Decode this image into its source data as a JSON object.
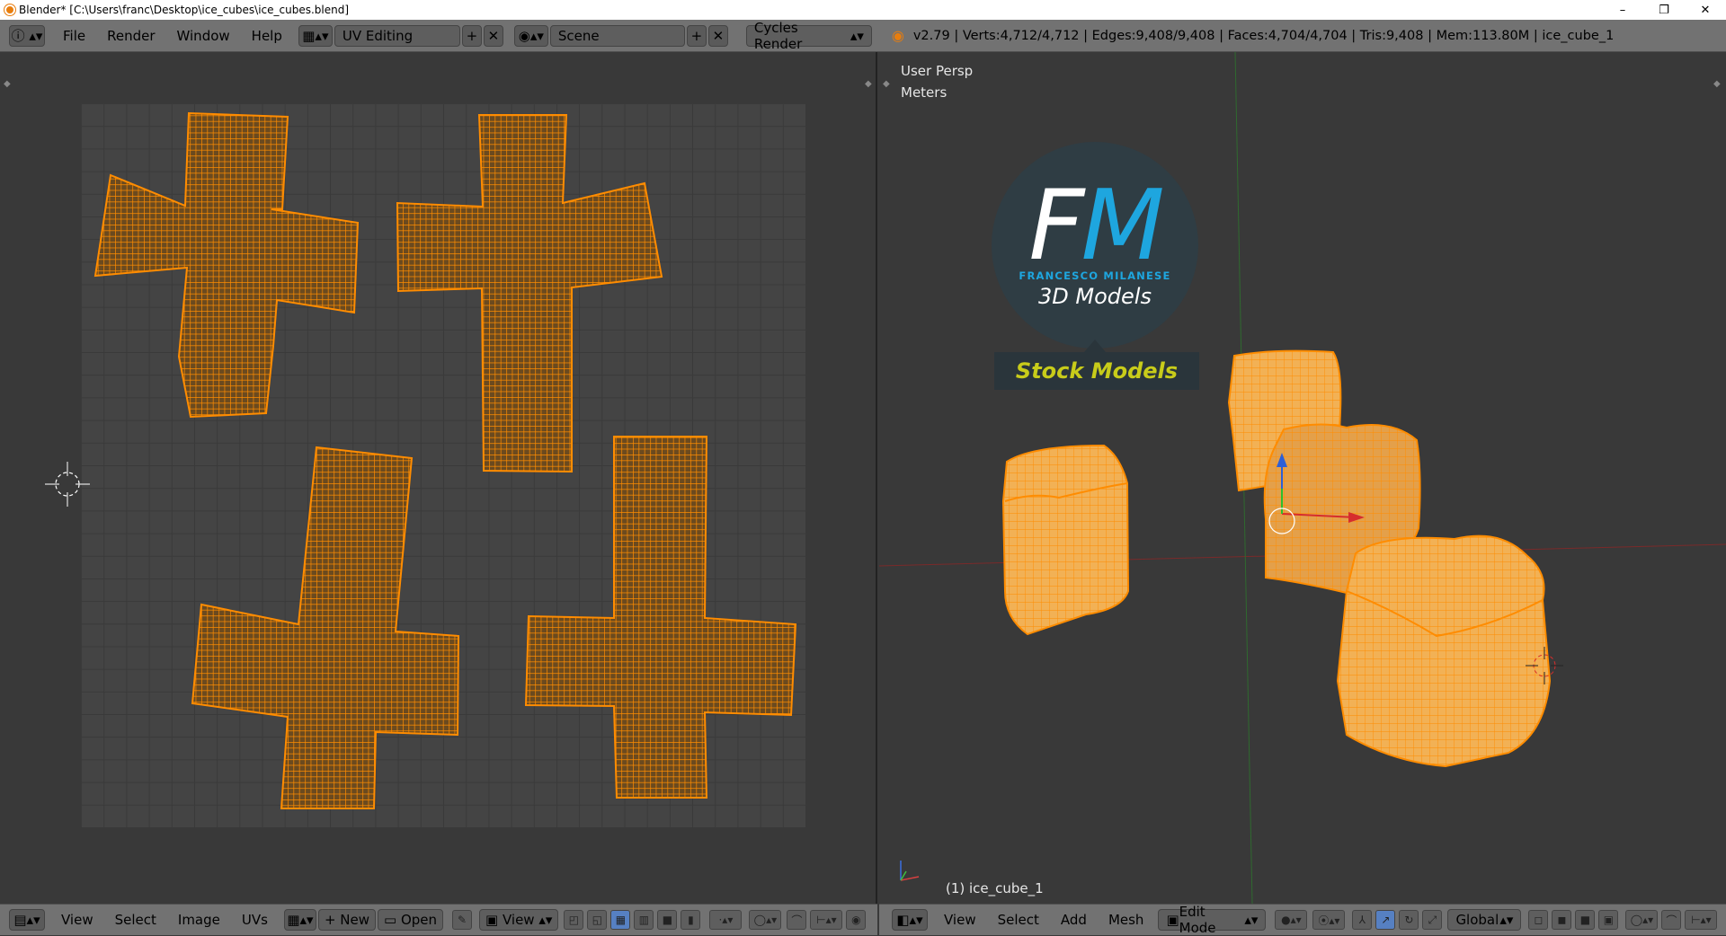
{
  "window": {
    "title": "Blender* [C:\\Users\\franc\\Desktop\\ice_cubes\\ice_cubes.blend]",
    "minimize": "–",
    "restore": "❐",
    "close": "✕"
  },
  "topbar": {
    "info_icon": "ⓘ",
    "menus": [
      "File",
      "Render",
      "Window",
      "Help"
    ],
    "screen_layout": "UV Editing",
    "scene": "Scene",
    "render_engine": "Cycles Render",
    "stats": "v2.79 | Verts:4,712/4,712 | Edges:9,408/9,408 | Faces:4,704/4,704 | Tris:9,408 | Mem:113.80M | ice_cube_1"
  },
  "viewport": {
    "view_label": "User Persp",
    "units_label": "Meters",
    "object_label": "(1) ice_cube_1",
    "logo": {
      "letters": "FM",
      "brand": "FRANCESCO MILANESE",
      "subtitle": "3D Models",
      "banner": "Stock Models"
    }
  },
  "uv_footer": {
    "menus": [
      "View",
      "Select",
      "Image",
      "UVs"
    ],
    "new_label": "New",
    "open_label": "Open",
    "view_label": "View"
  },
  "vp_footer": {
    "menus": [
      "View",
      "Select",
      "Add",
      "Mesh"
    ],
    "mode": "Edit Mode",
    "orientation": "Global"
  },
  "colors": {
    "mesh": "#ff8c00",
    "accent": "#5680c2",
    "logo_blue": "#1ea6df",
    "banner_yellow": "#c8cc1a"
  }
}
